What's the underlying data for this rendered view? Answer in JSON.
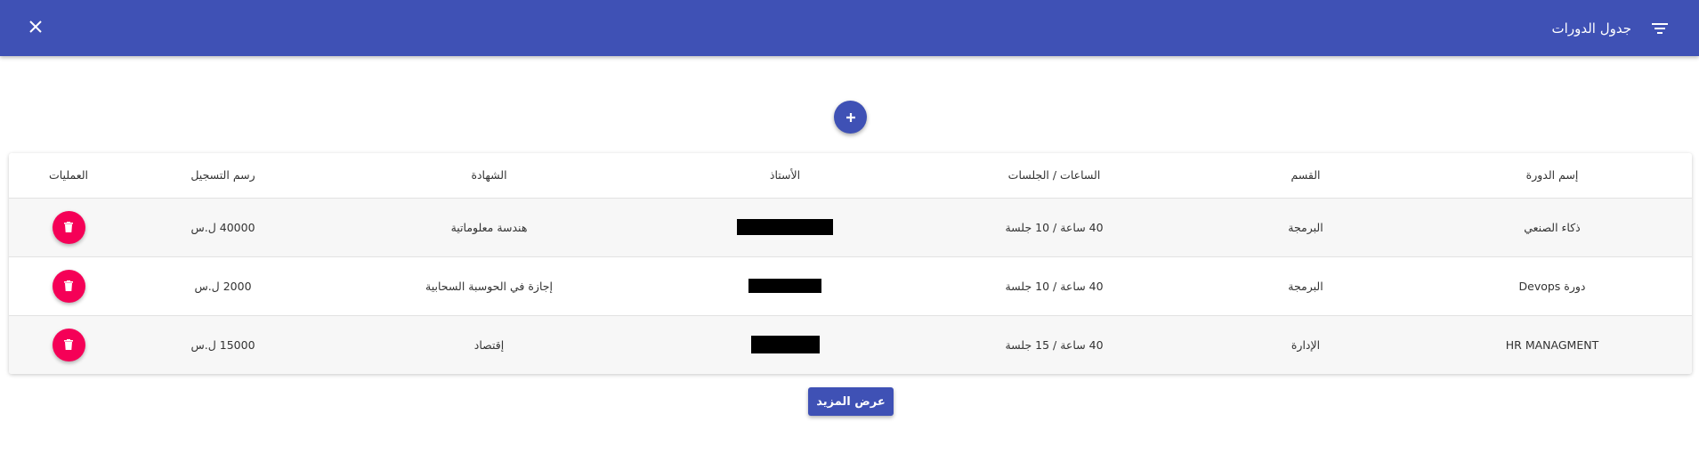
{
  "app_bar": {
    "title": "جدول الدورات",
    "close_icon": "close-icon",
    "filter_icon": "filter-icon",
    "color": "#3f51b5"
  },
  "add_button": {
    "icon": "plus-icon"
  },
  "table": {
    "headers": {
      "course_name": "إسم الدورة",
      "department": "القسم",
      "hours_sessions": "الساعات / الجلسات",
      "instructor": "الأستاذ",
      "certificate": "الشهادة",
      "fee": "رسم التسجيل",
      "operations": "العمليات"
    },
    "rows": [
      {
        "course_name": "ذكاء الصنعي",
        "department": "البرمجة",
        "hours_sessions": "40 ساعة / 10 جلسة",
        "instructor": "[redacted]",
        "certificate": "هندسة معلوماتية",
        "fee": "40000 ل.س",
        "delete_icon": "trash-icon"
      },
      {
        "course_name": "دورة Devops",
        "department": "البرمجة",
        "hours_sessions": "40 ساعة / 10 جلسة",
        "instructor": "[redacted]",
        "certificate": "إجازة في الحوسبة السحابية",
        "fee": "2000 ل.س",
        "delete_icon": "trash-icon"
      },
      {
        "course_name": "HR MANAGMENT",
        "department": "الإدارة",
        "hours_sessions": "40 ساعة / 15 جلسة",
        "instructor": "[redacted]",
        "certificate": "إقتصاد",
        "fee": "15000 ل.س",
        "delete_icon": "trash-icon"
      }
    ]
  },
  "more_button": {
    "label": "عرض المزيد"
  },
  "colors": {
    "primary": "#3f51b5",
    "delete": "#f50057"
  }
}
